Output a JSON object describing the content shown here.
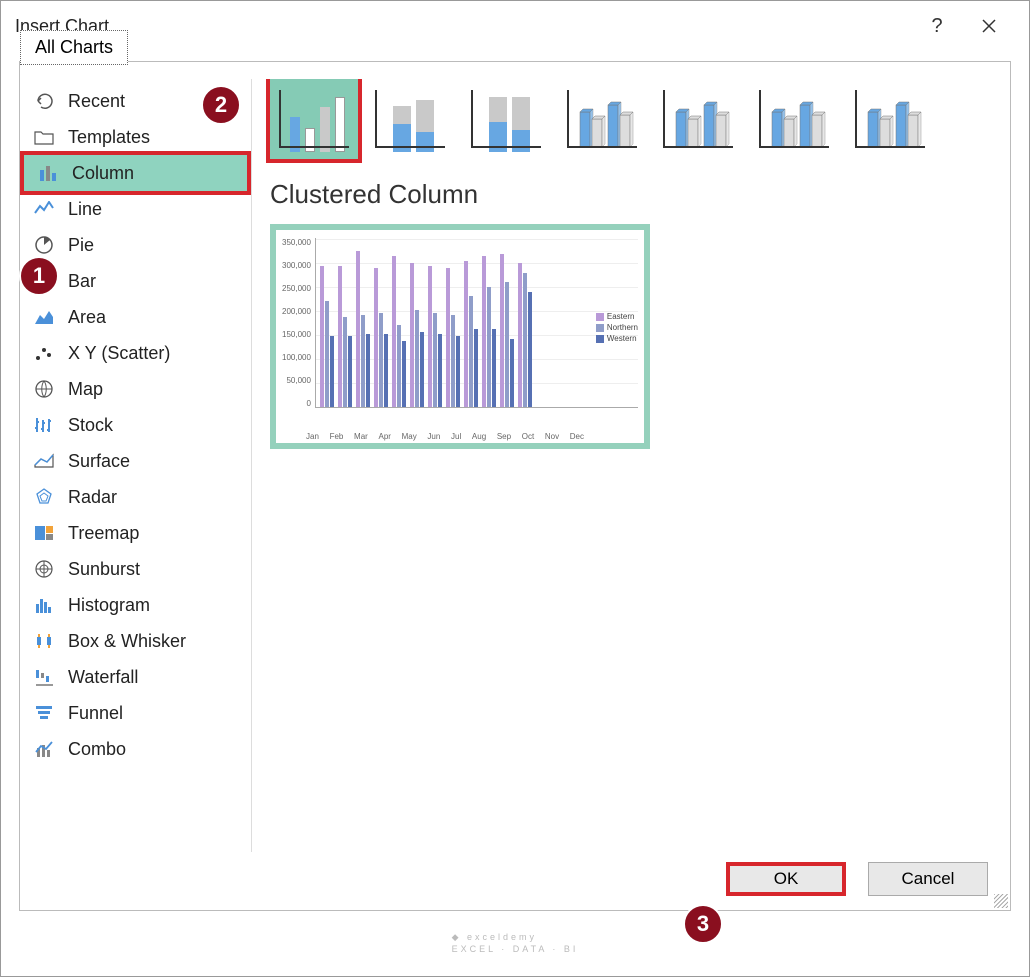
{
  "title": "Insert Chart",
  "tab_label": "All Charts",
  "sidebar": {
    "items": [
      {
        "label": "Recent",
        "icon": "undo"
      },
      {
        "label": "Templates",
        "icon": "folder"
      },
      {
        "label": "Column",
        "icon": "column",
        "selected": true
      },
      {
        "label": "Line",
        "icon": "line"
      },
      {
        "label": "Pie",
        "icon": "pie"
      },
      {
        "label": "Bar",
        "icon": "bar"
      },
      {
        "label": "Area",
        "icon": "area"
      },
      {
        "label": "X Y (Scatter)",
        "icon": "scatter"
      },
      {
        "label": "Map",
        "icon": "map"
      },
      {
        "label": "Stock",
        "icon": "stock"
      },
      {
        "label": "Surface",
        "icon": "surface"
      },
      {
        "label": "Radar",
        "icon": "radar"
      },
      {
        "label": "Treemap",
        "icon": "treemap"
      },
      {
        "label": "Sunburst",
        "icon": "sunburst"
      },
      {
        "label": "Histogram",
        "icon": "histogram"
      },
      {
        "label": "Box & Whisker",
        "icon": "box"
      },
      {
        "label": "Waterfall",
        "icon": "waterfall"
      },
      {
        "label": "Funnel",
        "icon": "funnel"
      },
      {
        "label": "Combo",
        "icon": "combo"
      }
    ]
  },
  "subtype_title": "Clustered Column",
  "subtypes": [
    {
      "name": "clustered-column",
      "selected": true
    },
    {
      "name": "stacked-column"
    },
    {
      "name": "100-stacked-column"
    },
    {
      "name": "3d-clustered-column"
    },
    {
      "name": "3d-stacked-column"
    },
    {
      "name": "3d-100-stacked-column"
    },
    {
      "name": "3d-column"
    }
  ],
  "chart_data": {
    "type": "bar",
    "title": "",
    "xlabel": "",
    "ylabel": "",
    "ylim": [
      0,
      350000
    ],
    "yticks": [
      0,
      50000,
      100000,
      150000,
      200000,
      250000,
      300000,
      350000
    ],
    "categories": [
      "Jan",
      "Feb",
      "Mar",
      "Apr",
      "May",
      "Jun",
      "Jul",
      "Aug",
      "Sep",
      "Oct",
      "Nov",
      "Dec"
    ],
    "series": [
      {
        "name": "Eastern",
        "color": "#b99ad8",
        "values": [
          300000,
          300000,
          330000,
          295000,
          320000,
          305000,
          300000,
          295000,
          310000,
          320000,
          325000,
          305000
        ]
      },
      {
        "name": "Northern",
        "color": "#8f9dc9",
        "values": [
          225000,
          190000,
          195000,
          200000,
          175000,
          205000,
          200000,
          195000,
          235000,
          255000,
          265000,
          285000
        ]
      },
      {
        "name": "Western",
        "color": "#5670b3",
        "values": [
          150000,
          150000,
          155000,
          155000,
          140000,
          160000,
          155000,
          150000,
          165000,
          165000,
          145000,
          245000
        ]
      }
    ]
  },
  "buttons": {
    "ok": "OK",
    "cancel": "Cancel"
  },
  "watermark": {
    "name": "exceldemy",
    "sub": "EXCEL · DATA · BI"
  },
  "callouts": [
    "1",
    "2",
    "3"
  ]
}
